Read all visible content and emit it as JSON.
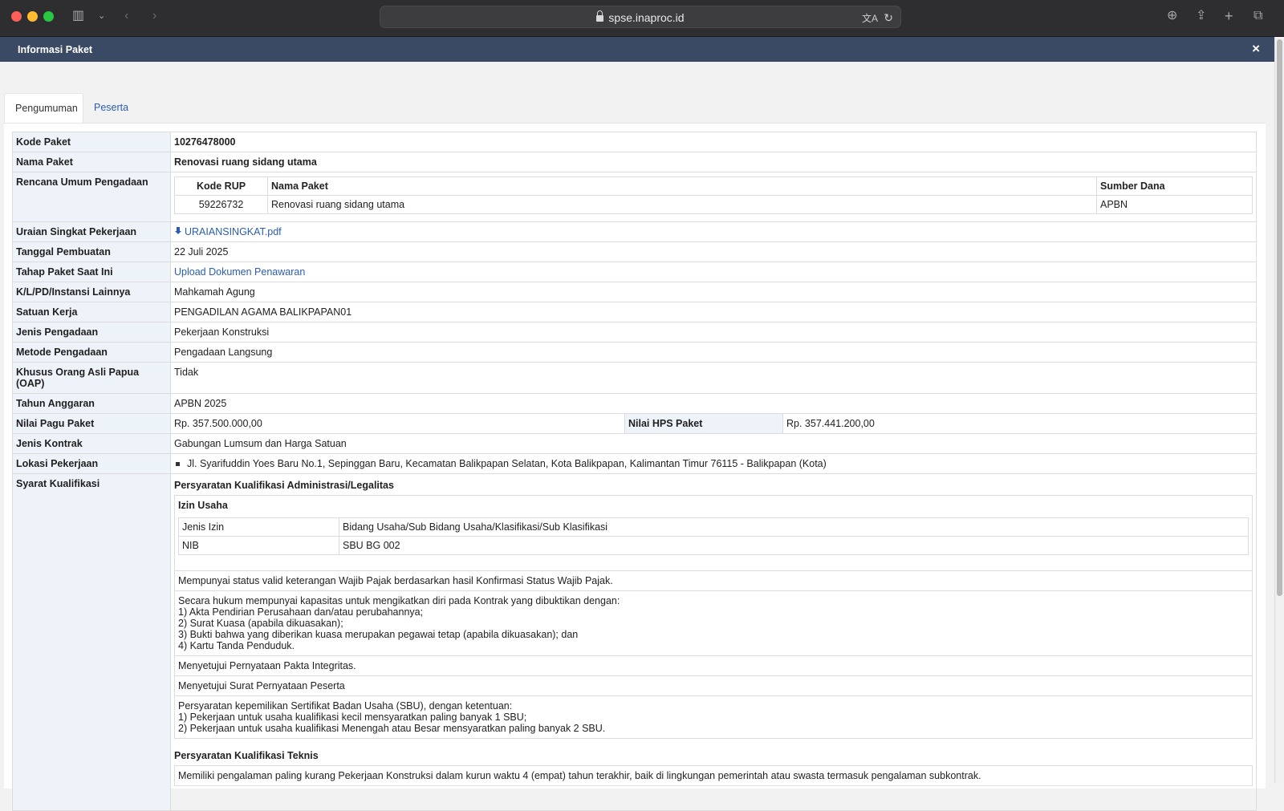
{
  "browser": {
    "url": "spse.inaproc.id"
  },
  "modal": {
    "title": "Informasi Paket",
    "close_label": "×"
  },
  "tabs": [
    {
      "label": "Pengumuman",
      "active": true
    },
    {
      "label": "Peserta",
      "active": false
    }
  ],
  "info": {
    "kode_paket": {
      "label": "Kode Paket",
      "value": "10276478000"
    },
    "nama_paket": {
      "label": "Nama Paket",
      "value": "Renovasi ruang sidang utama"
    },
    "rup": {
      "label": "Rencana Umum Pengadaan",
      "headers": [
        "Kode RUP",
        "Nama Paket",
        "Sumber Dana"
      ],
      "rows": [
        [
          "59226732",
          "Renovasi ruang sidang utama",
          "APBN"
        ]
      ]
    },
    "uraian": {
      "label": "Uraian Singkat Pekerjaan",
      "file": "URAIANSINGKAT.pdf"
    },
    "tanggal": {
      "label": "Tanggal Pembuatan",
      "value": "22 Juli 2025"
    },
    "tahap": {
      "label": "Tahap Paket Saat Ini",
      "value": "Upload Dokumen Penawaran"
    },
    "instansi": {
      "label": "K/L/PD/Instansi Lainnya",
      "value": "Mahkamah Agung"
    },
    "satker": {
      "label": "Satuan Kerja",
      "value": "PENGADILAN AGAMA BALIKPAPAN01"
    },
    "jenis_pengadaan": {
      "label": "Jenis Pengadaan",
      "value": "Pekerjaan Konstruksi"
    },
    "metode": {
      "label": "Metode Pengadaan",
      "value": "Pengadaan Langsung"
    },
    "oap": {
      "label": "Khusus Orang Asli Papua (OAP)",
      "value": "Tidak"
    },
    "tahun": {
      "label": "Tahun Anggaran",
      "value": "APBN 2025"
    },
    "pagu": {
      "label": "Nilai Pagu Paket",
      "value": "Rp. 357.500.000,00",
      "hps_label": "Nilai HPS Paket",
      "hps_value": "Rp. 357.441.200,00"
    },
    "kontrak": {
      "label": "Jenis Kontrak",
      "value": "Gabungan Lumsum dan Harga Satuan"
    },
    "lokasi": {
      "label": "Lokasi Pekerjaan",
      "value": "Jl. Syarifuddin Yoes Baru No.1, Sepinggan Baru, Kecamatan Balikpapan Selatan, Kota Balikpapan, Kalimantan Timur 76115 - Balikpapan (Kota)"
    },
    "syarat": {
      "label": "Syarat Kualifikasi",
      "admin_title": "Persyaratan Kualifikasi Administrasi/Legalitas",
      "izin_title": "Izin Usaha",
      "izin_rows": [
        [
          "Jenis Izin",
          "Bidang Usaha/Sub Bidang Usaha/Klasifikasi/Sub Klasifikasi"
        ],
        [
          "NIB",
          "SBU BG 002"
        ]
      ],
      "items": [
        "Mempunyai status valid keterangan Wajib Pajak berdasarkan hasil Konfirmasi Status Wajib Pajak.",
        "Secara hukum mempunyai kapasitas untuk mengikatkan diri pada Kontrak yang dibuktikan dengan:\n1) Akta Pendirian Perusahaan dan/atau perubahannya;\n2) Surat Kuasa (apabila dikuasakan);\n3) Bukti bahwa yang diberikan kuasa merupakan pegawai tetap (apabila dikuasakan); dan\n4) Kartu Tanda Penduduk.",
        "Menyetujui Pernyataan Pakta Integritas.",
        "Menyetujui Surat Pernyataan Peserta",
        "Persyaratan kepemilikan Sertifikat Badan Usaha (SBU), dengan ketentuan:\n1) Pekerjaan untuk usaha kualifikasi kecil mensyaratkan paling banyak 1 SBU;\n2) Pekerjaan untuk usaha kualifikasi Menengah atau Besar mensyaratkan paling banyak 2 SBU."
      ],
      "teknis_title": "Persyaratan Kualifikasi Teknis",
      "teknis_items": [
        "Memiliki pengalaman paling kurang Pekerjaan Konstruksi dalam kurun waktu 4 (empat) tahun terakhir, baik di lingkungan pemerintah atau swasta termasuk pengalaman subkontrak."
      ]
    }
  }
}
